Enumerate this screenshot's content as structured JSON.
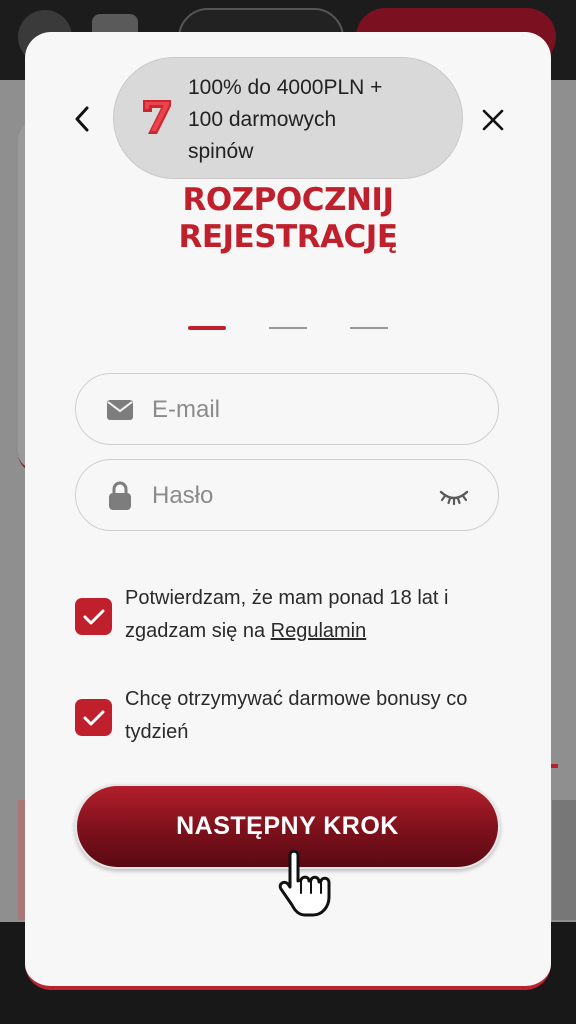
{
  "promo": {
    "icon": "seven-slot-icon",
    "line1": "100% do 4000PLN +",
    "line2": "100 darmowych",
    "line3": "spinów"
  },
  "title": {
    "line1": "ROZPOCZNIJ",
    "line2": "REJESTRACJĘ"
  },
  "steps": {
    "current": 1,
    "total": 3
  },
  "form": {
    "email_placeholder": "E-mail",
    "email_value": "",
    "password_placeholder": "Hasło",
    "password_value": ""
  },
  "consents": {
    "age": {
      "checked": true,
      "text_before": "Potwierdzam, że mam ponad 18 lat i zgadzam się na ",
      "link": "Regulamin"
    },
    "bonus": {
      "checked": true,
      "text": "Chcę otrzymywać darmowe bonusy co tydzień"
    }
  },
  "cta": {
    "label": "NASTĘPNY KROK"
  },
  "colors": {
    "accent": "#c0202c",
    "cta_dark": "#7c101b",
    "promo_bg": "#d9d9d9"
  }
}
